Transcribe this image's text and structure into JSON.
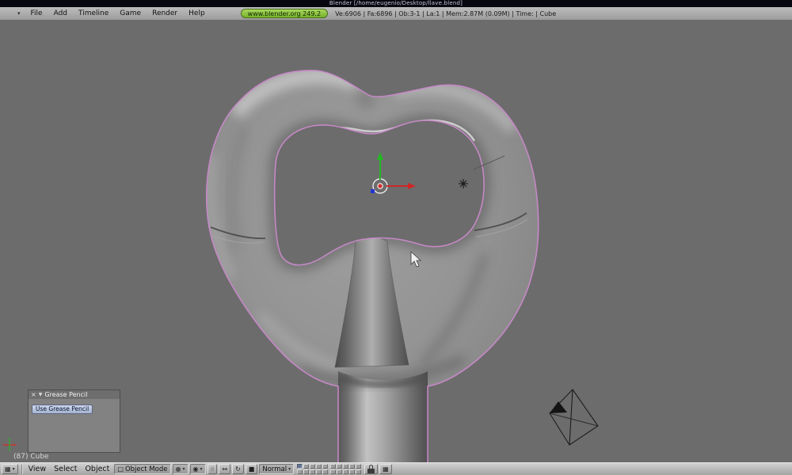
{
  "colors": {
    "titlebar_bg": "#07070f",
    "menubar_bg": "#a8a8a8",
    "viewport_bg": "#6c6c6c",
    "header_bg": "#d0d0d0",
    "badge_bg": "#8dc63f",
    "selection_outline": "#c989c9",
    "model_mid": "#919191"
  },
  "title_bar": {
    "title": "Blender [/home/eugenio/Desktop/llave.blend]"
  },
  "menu_bar": {
    "menus": [
      {
        "label": "File"
      },
      {
        "label": "Add"
      },
      {
        "label": "Timeline"
      },
      {
        "label": "Game"
      },
      {
        "label": "Render"
      },
      {
        "label": "Help"
      }
    ],
    "version_badge": "www.blender.org 249.2",
    "stats": "Ve:6906 | Fa:6896 | Ob:3-1 | La:1 | Mem:2.87M (0.09M) | Time: | Cube"
  },
  "viewport": {
    "object_info": "(87) Cube",
    "grease_pencil_panel": {
      "title": "Grease Pencil",
      "use_button": "Use Grease Pencil"
    }
  },
  "header3d": {
    "menus": [
      {
        "label": "View"
      },
      {
        "label": "Select"
      },
      {
        "label": "Object"
      }
    ],
    "mode": "Object Mode",
    "orientation": "Normal",
    "layers": {
      "count": 20,
      "active": 1
    }
  },
  "icons": {
    "menu_collapse": "▾",
    "close": "×",
    "collapse_arrow": "▼",
    "editor_type": "▦",
    "dropdown_arrow": "▾",
    "mode_cube": "□",
    "draw_type_sphere": "●",
    "pivot": "◉",
    "hand": "☝",
    "translate": "↔",
    "rotate": "↻",
    "scale": "■",
    "render_grid": "▦"
  }
}
